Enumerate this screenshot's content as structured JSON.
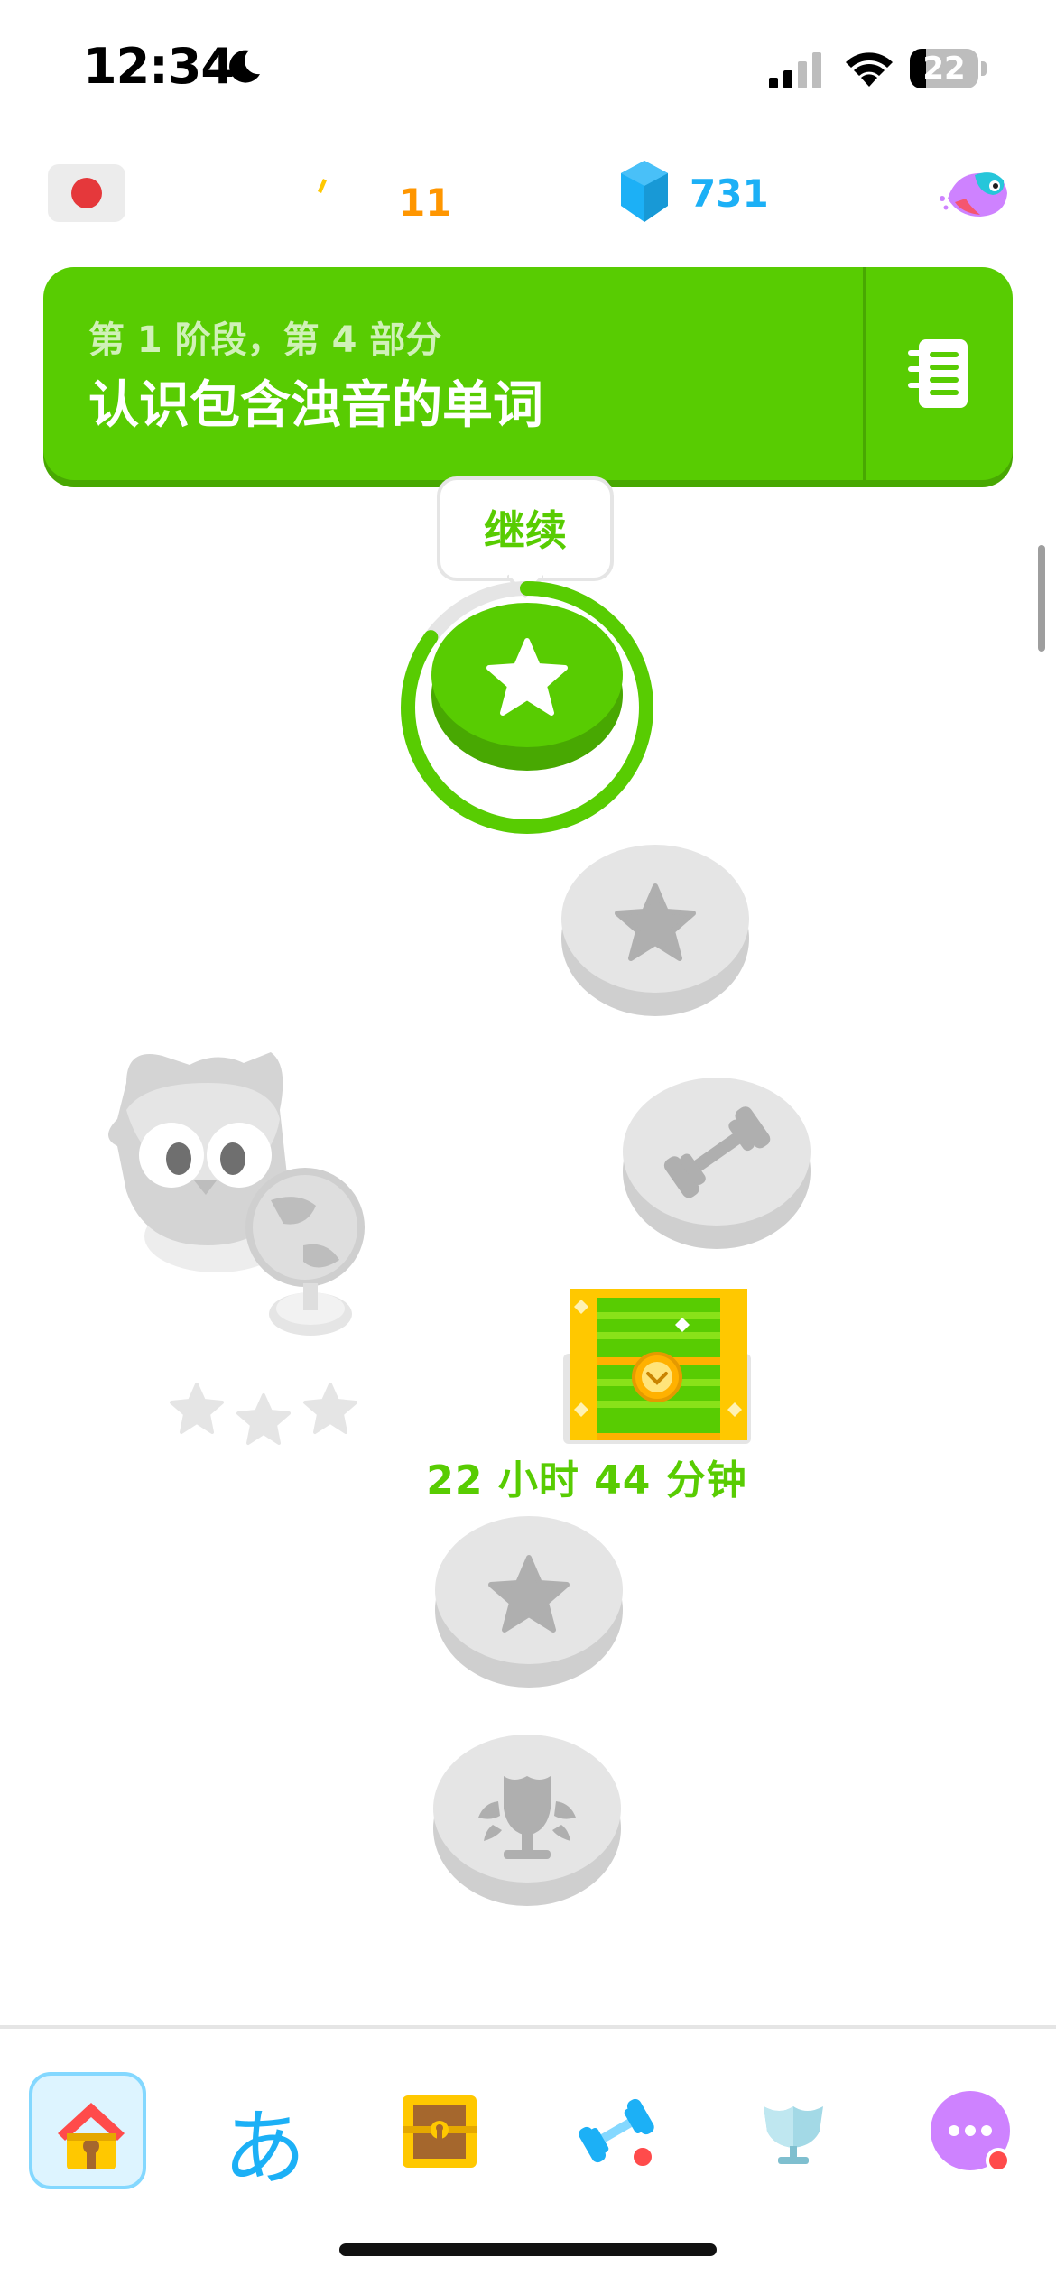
{
  "status_bar": {
    "time": "12:34",
    "battery": "22"
  },
  "stats": {
    "streak": "11",
    "gems": "731"
  },
  "unit": {
    "subtitle": "第 1 阶段，第 4 部分",
    "title": "认识包含浊音的单词"
  },
  "path": {
    "continue_label": "继续",
    "chest_timer": "22 小时 44 分钟",
    "current_progress": 0.85
  },
  "colors": {
    "accent_green": "#58cc02",
    "gem_blue": "#1cb0f6",
    "streak_orange": "#ff9600",
    "locked_gray": "#e5e5e5",
    "badge_red": "#ff4b4b"
  },
  "bottom_nav": {
    "items": [
      {
        "name": "home",
        "icon": "house-icon",
        "active": true
      },
      {
        "name": "characters",
        "icon": "kana-icon",
        "label": "あ"
      },
      {
        "name": "chest",
        "icon": "treasure-chest-icon"
      },
      {
        "name": "practice",
        "icon": "dumbbell-icon",
        "badge": true
      },
      {
        "name": "leaderboard",
        "icon": "trophy-icon"
      },
      {
        "name": "more",
        "icon": "more-icon",
        "badge": true
      }
    ]
  }
}
